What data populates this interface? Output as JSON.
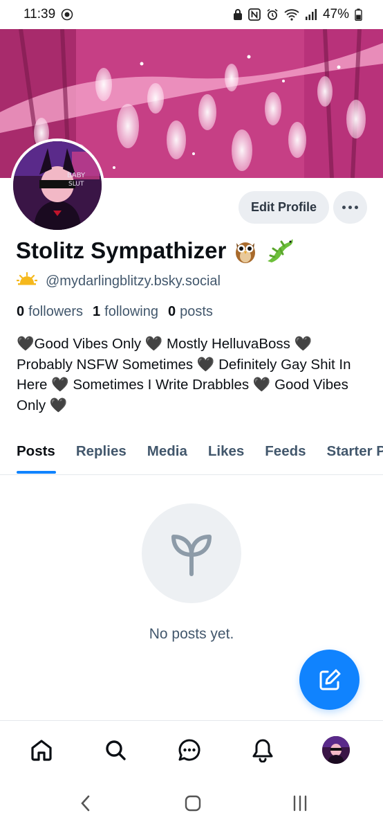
{
  "status_bar": {
    "time": "11:39",
    "battery": "47%"
  },
  "profile": {
    "display_name": "Stolitz Sympathizer",
    "name_emojis": [
      "owl",
      "lizard"
    ],
    "handle": "@mydarlingblitzy.bsky.social",
    "stats": {
      "followers_count": "0",
      "followers_label": "followers",
      "following_count": "1",
      "following_label": "following",
      "posts_count": "0",
      "posts_label": "posts"
    },
    "bio": "🖤Good Vibes Only 🖤 Mostly HelluvaBoss 🖤 Probably NSFW Sometimes 🖤 Definitely Gay Shit In Here 🖤 Sometimes I Write Drabbles 🖤 Good Vibes Only 🖤",
    "avatar_text": "BABY SLUT"
  },
  "actions": {
    "edit_profile": "Edit Profile",
    "more": "more-options"
  },
  "tabs": [
    {
      "label": "Posts",
      "active": true
    },
    {
      "label": "Replies",
      "active": false
    },
    {
      "label": "Media",
      "active": false
    },
    {
      "label": "Likes",
      "active": false
    },
    {
      "label": "Feeds",
      "active": false
    },
    {
      "label": "Starter Packs",
      "active": false
    }
  ],
  "empty_state": {
    "icon": "sprout-icon",
    "text": "No posts yet."
  },
  "bottom_nav": [
    "home-icon",
    "search-icon",
    "chat-icon",
    "bell-icon",
    "profile-avatar"
  ],
  "colors": {
    "accent": "#1083fe",
    "secondary_text": "#42576c",
    "button_bg": "#ebeef2"
  }
}
